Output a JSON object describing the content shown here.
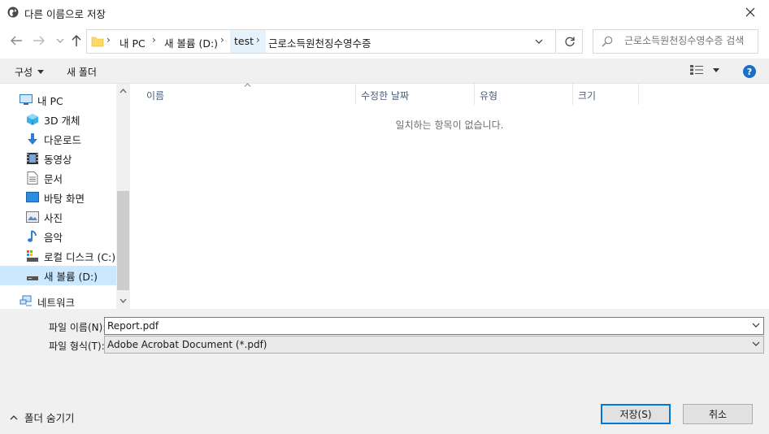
{
  "window": {
    "title": "다른 이름으로 저장"
  },
  "address": {
    "breadcrumbs": [
      "내 PC",
      "새 볼륨 (D:)",
      "test",
      "근로소득원천징수영수증"
    ],
    "search_placeholder": "근로소득원천징수영수증 검색"
  },
  "toolbar": {
    "organize_label": "구성",
    "new_folder_label": "새 폴더",
    "help_label": "?"
  },
  "nav": {
    "items": [
      {
        "label": "내 PC",
        "icon": "computer-icon"
      },
      {
        "label": "3D 개체",
        "icon": "3d-objects-icon"
      },
      {
        "label": "다운로드",
        "icon": "download-icon"
      },
      {
        "label": "동영상",
        "icon": "video-icon"
      },
      {
        "label": "문서",
        "icon": "document-icon"
      },
      {
        "label": "바탕 화면",
        "icon": "desktop-icon"
      },
      {
        "label": "사진",
        "icon": "picture-icon"
      },
      {
        "label": "음악",
        "icon": "music-icon"
      },
      {
        "label": "로컬 디스크 (C:)",
        "icon": "drive-icon"
      },
      {
        "label": "새 볼륨 (D:)",
        "icon": "drive-icon"
      },
      {
        "label": "네트워크",
        "icon": "network-icon"
      }
    ]
  },
  "files": {
    "columns": [
      "이름",
      "수정한 날짜",
      "유형",
      "크기"
    ],
    "empty_message": "일치하는 항목이 없습니다."
  },
  "form": {
    "filename_label": "파일 이름(N):",
    "filename_value": "Report.pdf",
    "filetype_label": "파일 형식(T):",
    "filetype_value": "Adobe Acrobat Document (*.pdf)"
  },
  "footer": {
    "hide_folders_label": "폴더 숨기기",
    "save_label": "저장(S)",
    "cancel_label": "취소"
  },
  "colors": {
    "accent": "#0078d7",
    "selection": "#cce8ff",
    "help": "#1a6fc9"
  }
}
